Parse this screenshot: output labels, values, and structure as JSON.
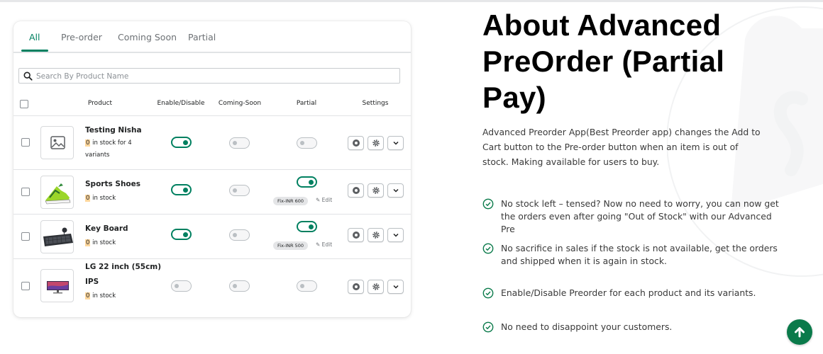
{
  "tabs": [
    "All",
    "Pre-order",
    "Coming Soon",
    "Partial"
  ],
  "search": {
    "placeholder": "Search By Product Name"
  },
  "columns": {
    "product": "Product",
    "enable": "Enable/Disable",
    "coming_soon": "Coming-Soon",
    "partial": "Partial",
    "settings": "Settings"
  },
  "products": [
    {
      "name": "Testing Nisha",
      "stock_count": "0",
      "stock_text_1": " in stock for 4",
      "stock_text_2": "variants",
      "enabled": true,
      "coming_soon": false,
      "partial": false
    },
    {
      "name": "Sports Shoes",
      "stock_count": "0",
      "stock_text_1": " in stock",
      "enabled": true,
      "coming_soon": false,
      "partial": true,
      "fix": "Fix-INR 600",
      "edit": "Edit"
    },
    {
      "name": "Key Board",
      "stock_count": "0",
      "stock_text_1": " in stock",
      "enabled": true,
      "coming_soon": false,
      "partial": true,
      "fix": "Fix-INR 500",
      "edit": "Edit"
    },
    {
      "name_line1": "LG 22 inch (55cm)",
      "name_line2": "IPS",
      "stock_count": "0",
      "stock_text_1": " in stock",
      "enabled": false,
      "coming_soon": false,
      "partial": false
    }
  ],
  "about": {
    "title": "About Advanced PreOrder (Partial Pay)",
    "description": "Advanced Preorder App(Best Preorder app) changes the Add to Cart button to the Pre-order button when an item is out of stock. Making available for users to buy.",
    "features": [
      "No stock left – tensed? Now no need to worry, you can now get the orders even after going \"Out of Stock\" with our Advanced Pre",
      "No sacrifice in sales if the stock is not available, get the orders and shipped when it is again in stock.",
      "Enable/Disable Preorder for each product and its variants.",
      "No need to disappoint your customers."
    ]
  },
  "colors": {
    "accent": "#008060",
    "stock_highlight": "#ffd79d",
    "fab": "#0a7a4a"
  },
  "icons": {
    "search": "search-icon",
    "thumb_placeholder": "image-placeholder-icon",
    "eye": "eye-icon",
    "gear": "gear-icon",
    "chevron": "chevron-down-icon",
    "check": "check-circle-icon",
    "arrow_up": "arrow-up-icon"
  }
}
